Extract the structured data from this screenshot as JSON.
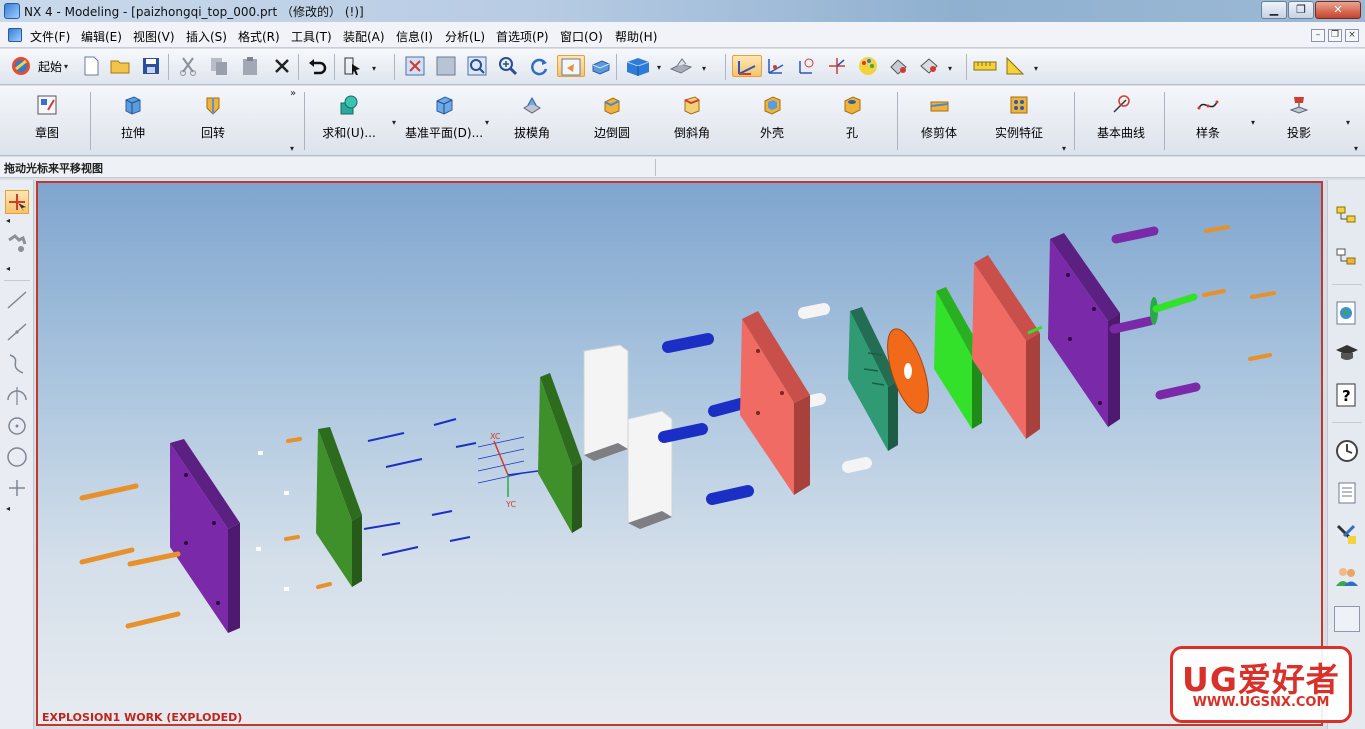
{
  "window": {
    "title": "NX 4 - Modeling - [paizhongqi_top_000.prt （修改的）   (!)]",
    "min": "▁",
    "max": "❐",
    "close": "✕"
  },
  "menu": {
    "items": [
      "文件(F)",
      "编辑(E)",
      "视图(V)",
      "插入(S)",
      "格式(R)",
      "工具(T)",
      "装配(A)",
      "信息(I)",
      "分析(L)",
      "首选项(P)",
      "窗口(O)",
      "帮助(H)"
    ],
    "mdi_min": "–",
    "mdi_restore": "❐",
    "mdi_close": "×"
  },
  "standard_toolbar": {
    "start_label": "起始",
    "icons": [
      "start-icon",
      "new-icon",
      "open-icon",
      "save-icon",
      "cut-icon",
      "copy-icon",
      "paste-icon",
      "delete-icon",
      "undo-icon",
      "selection-filter-icon",
      "fit-icon",
      "zoom-window-icon",
      "zoom-icon",
      "zoom-in-out-icon",
      "rotate-icon",
      "pan-icon",
      "orient-view-icon",
      "render-style-icon",
      "view-triad-icon",
      "wcs-icon",
      "measure-distance-icon",
      "measure-angle-icon"
    ]
  },
  "feature_toolbar": {
    "sketch": "章图",
    "extrude": "拉伸",
    "revolve": "回转",
    "unite": "求和(U)...",
    "datum_plane": "基准平面(D)...",
    "draft": "拔模角",
    "edge_blend": "边倒圆",
    "chamfer": "倒斜角",
    "shell": "外壳",
    "hole": "孔",
    "trim_body": "修剪体",
    "instance_feature": "实例特征",
    "basic_curves": "基本曲线",
    "spline": "样条",
    "project": "投影"
  },
  "status": {
    "prompt": "拖动光标来平移视图"
  },
  "viewport": {
    "label": "EXPLOSION1 WORK (EXPLODED)",
    "wcs_xc": "XC",
    "wcs_yc": "YC"
  },
  "colors": {
    "purple_plate": "#7a2aa8",
    "green_plate": "#3f8f2a",
    "bright_green": "#33e12b",
    "salmon_plate": "#f06b63",
    "teal_plate": "#2f9a73",
    "orange_disc": "#f06a1a",
    "blue_pin": "#1c2fc4",
    "orange_screw": "#e8902a",
    "white_block": "#f4f4f4",
    "selection_border": "#c0392b"
  },
  "watermark": {
    "main": "UG爱好者",
    "sub": "WWW.UGSNX.COM"
  }
}
